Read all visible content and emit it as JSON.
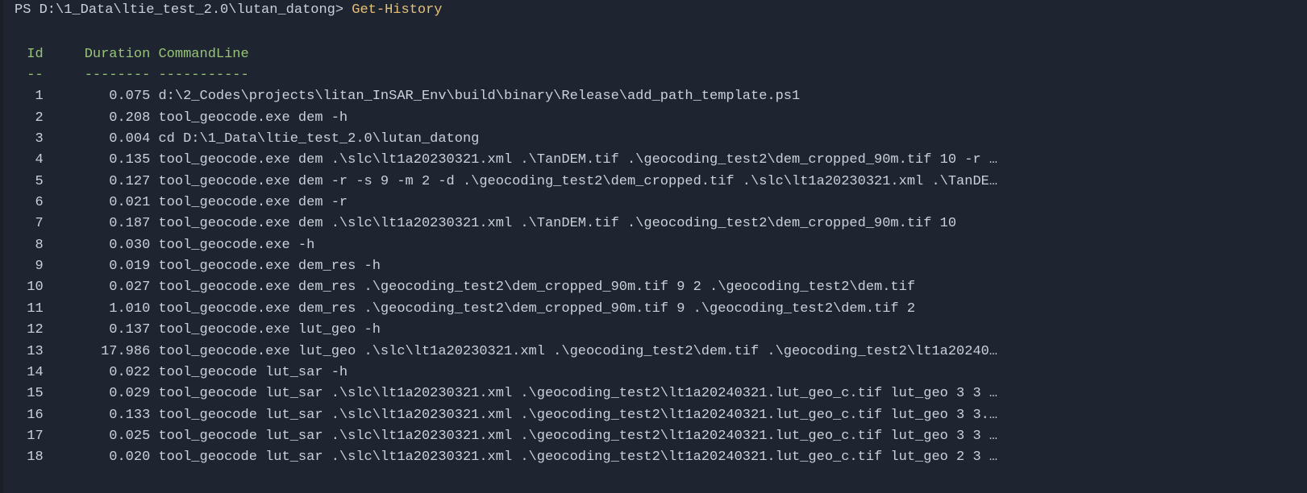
{
  "prompt": {
    "prefix": "PS ",
    "path": "D:\\1_Data\\ltie_test_2.0\\lutan_datong",
    "separator": "> ",
    "command": "Get-History"
  },
  "headers": {
    "id": "Id",
    "duration": "Duration",
    "commandline": "CommandLine"
  },
  "dividers": {
    "id": "--",
    "duration": "--------",
    "commandline": "-----------"
  },
  "rows": [
    {
      "id": "1",
      "duration": "0.075",
      "cmd": "d:\\2_Codes\\projects\\litan_InSAR_Env\\build\\binary\\Release\\add_path_template.ps1"
    },
    {
      "id": "2",
      "duration": "0.208",
      "cmd": "tool_geocode.exe dem -h"
    },
    {
      "id": "3",
      "duration": "0.004",
      "cmd": "cd D:\\1_Data\\ltie_test_2.0\\lutan_datong"
    },
    {
      "id": "4",
      "duration": "0.135",
      "cmd": "tool_geocode.exe dem .\\slc\\lt1a20230321.xml .\\TanDEM.tif .\\geocoding_test2\\dem_cropped_90m.tif 10 -r …"
    },
    {
      "id": "5",
      "duration": "0.127",
      "cmd": "tool_geocode.exe dem -r -s 9 -m 2 -d .\\geocoding_test2\\dem_cropped.tif .\\slc\\lt1a20230321.xml .\\TanDE…"
    },
    {
      "id": "6",
      "duration": "0.021",
      "cmd": "tool_geocode.exe dem -r"
    },
    {
      "id": "7",
      "duration": "0.187",
      "cmd": "tool_geocode.exe dem .\\slc\\lt1a20230321.xml .\\TanDEM.tif .\\geocoding_test2\\dem_cropped_90m.tif 10"
    },
    {
      "id": "8",
      "duration": "0.030",
      "cmd": "tool_geocode.exe -h"
    },
    {
      "id": "9",
      "duration": "0.019",
      "cmd": "tool_geocode.exe dem_res -h"
    },
    {
      "id": "10",
      "duration": "0.027",
      "cmd": "tool_geocode.exe dem_res .\\geocoding_test2\\dem_cropped_90m.tif 9 2 .\\geocoding_test2\\dem.tif"
    },
    {
      "id": "11",
      "duration": "1.010",
      "cmd": "tool_geocode.exe dem_res .\\geocoding_test2\\dem_cropped_90m.tif 9 .\\geocoding_test2\\dem.tif 2"
    },
    {
      "id": "12",
      "duration": "0.137",
      "cmd": "tool_geocode.exe lut_geo -h"
    },
    {
      "id": "13",
      "duration": "17.986",
      "cmd": "tool_geocode.exe lut_geo .\\slc\\lt1a20230321.xml .\\geocoding_test2\\dem.tif .\\geocoding_test2\\lt1a20240…"
    },
    {
      "id": "14",
      "duration": "0.022",
      "cmd": "tool_geocode lut_sar -h"
    },
    {
      "id": "15",
      "duration": "0.029",
      "cmd": "tool_geocode lut_sar .\\slc\\lt1a20230321.xml .\\geocoding_test2\\lt1a20240321.lut_geo_c.tif lut_geo 3 3 …"
    },
    {
      "id": "16",
      "duration": "0.133",
      "cmd": "tool_geocode lut_sar .\\slc\\lt1a20230321.xml .\\geocoding_test2\\lt1a20240321.lut_geo_c.tif lut_geo 3 3.…"
    },
    {
      "id": "17",
      "duration": "0.025",
      "cmd": "tool_geocode lut_sar .\\slc\\lt1a20230321.xml .\\geocoding_test2\\lt1a20240321.lut_geo_c.tif lut_geo 3 3 …"
    },
    {
      "id": "18",
      "duration": "0.020",
      "cmd": "tool_geocode lut_sar .\\slc\\lt1a20230321.xml .\\geocoding_test2\\lt1a20240321.lut_geo_c.tif lut_geo 2 3 …"
    }
  ]
}
